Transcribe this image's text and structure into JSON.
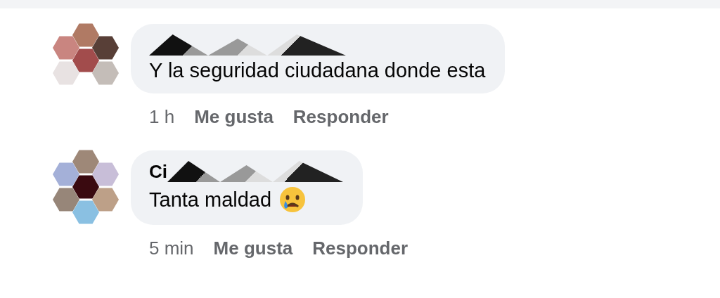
{
  "comments": [
    {
      "author_redacted": true,
      "text": "Y la seguridad ciudadana donde esta",
      "emoji": false,
      "time": "1 h",
      "actions": [
        "Me gusta",
        "Responder"
      ]
    },
    {
      "author": "Ci",
      "author_redacted": true,
      "text": "Tanta maldad",
      "emoji": true,
      "time": "5 min",
      "actions": [
        "Me gusta",
        "Responder"
      ]
    }
  ]
}
